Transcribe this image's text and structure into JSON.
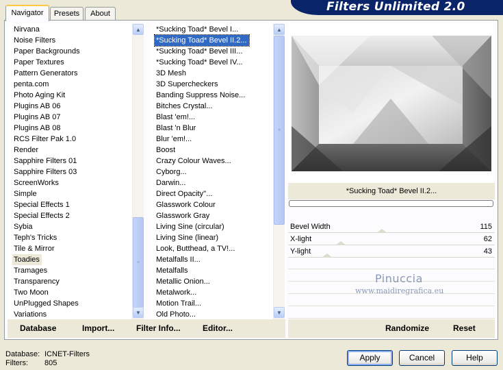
{
  "header": {
    "title": "Filters Unlimited 2.0"
  },
  "tabs": [
    {
      "label": "Navigator",
      "active": true
    },
    {
      "label": "Presets",
      "active": false
    },
    {
      "label": "About",
      "active": false
    }
  ],
  "categories": {
    "items": [
      "Nirvana",
      "Noise Filters",
      "Paper Backgrounds",
      "Paper Textures",
      "Pattern Generators",
      "penta.com",
      "Photo Aging Kit",
      "Plugins AB 06",
      "Plugins AB 07",
      "Plugins AB 08",
      "RCS Filter Pak 1.0",
      "Render",
      "Sapphire Filters 01",
      "Sapphire Filters 03",
      "ScreenWorks",
      "Simple",
      "Special Effects 1",
      "Special Effects 2",
      "Sybia",
      "Teph's Tricks",
      "Tile & Mirror",
      "Toadies",
      "Tramages",
      "Transparency",
      "Two Moon",
      "UnPlugged Shapes",
      "Variations"
    ],
    "selected": "Toadies"
  },
  "filters": {
    "items": [
      "*Sucking Toad*  Bevel I...",
      "*Sucking Toad*  Bevel II.2...",
      "*Sucking Toad*  Bevel III...",
      "*Sucking Toad*  Bevel IV...",
      "3D Mesh",
      "3D Supercheckers",
      "Banding Suppress Noise...",
      "Bitches Crystal...",
      "Blast 'em!...",
      "Blast 'n Blur",
      "Blur 'em!...",
      "Boost",
      "Crazy Colour Waves...",
      "Cyborg...",
      "Darwin...",
      "Direct Opacity''...",
      "Glasswork Colour",
      "Glasswork Gray",
      "Living Sine (circular)",
      "Living Sine (linear)",
      "Look, Butthead, a TV!...",
      "Metalfalls II...",
      "Metalfalls",
      "Metallic Onion...",
      "Metalwork...",
      "Motion Trail...",
      "Old Photo..."
    ],
    "selected": "*Sucking Toad*  Bevel II.2..."
  },
  "toolbar": {
    "database": "Database",
    "import": "Import...",
    "filter_info": "Filter Info...",
    "editor": "Editor...",
    "randomize": "Randomize",
    "reset": "Reset"
  },
  "preview": {
    "filter_name": "*Sucking Toad*  Bevel II.2...",
    "progress": 0
  },
  "params": [
    {
      "name": "Bevel Width",
      "value": "115",
      "level": 0.45
    },
    {
      "name": "X-light",
      "value": "62",
      "level": 0.24
    },
    {
      "name": "Y-light",
      "value": "43",
      "level": 0.17
    }
  ],
  "watermark": {
    "line1": "Pinuccia",
    "line2": "www.maidiregrafica.eu"
  },
  "footer": {
    "database_label": "Database:",
    "database_value": "ICNET-Filters",
    "filters_label": "Filters:",
    "filters_value": "805",
    "apply": "Apply",
    "cancel": "Cancel",
    "help": "Help"
  }
}
